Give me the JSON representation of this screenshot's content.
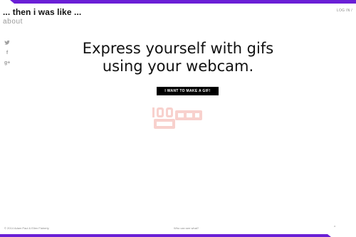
{
  "header": {
    "brand": "... then i was like ...",
    "about_label": "about",
    "login_label": "LOG IN /"
  },
  "social": [
    {
      "icon": "twitter-icon",
      "glyph": "🐦"
    },
    {
      "icon": "facebook-icon",
      "glyph": "f"
    },
    {
      "icon": "google-plus-icon",
      "glyph": "g+"
    }
  ],
  "hero": {
    "headline_line1": "Express yourself with gifs",
    "headline_line2": "using your webcam.",
    "cta_label": "I WANT TO MAKE A GIF!"
  },
  "watermark": {
    "icon": "gif-watermark-icon"
  },
  "footer": {
    "copyright": "© 2014 Adam Paul & Ellen Flaherty",
    "center_link": "Who can see what?",
    "caret": "^"
  },
  "colors": {
    "accent": "#6a1fd6",
    "watermark": "#e74c3c"
  }
}
